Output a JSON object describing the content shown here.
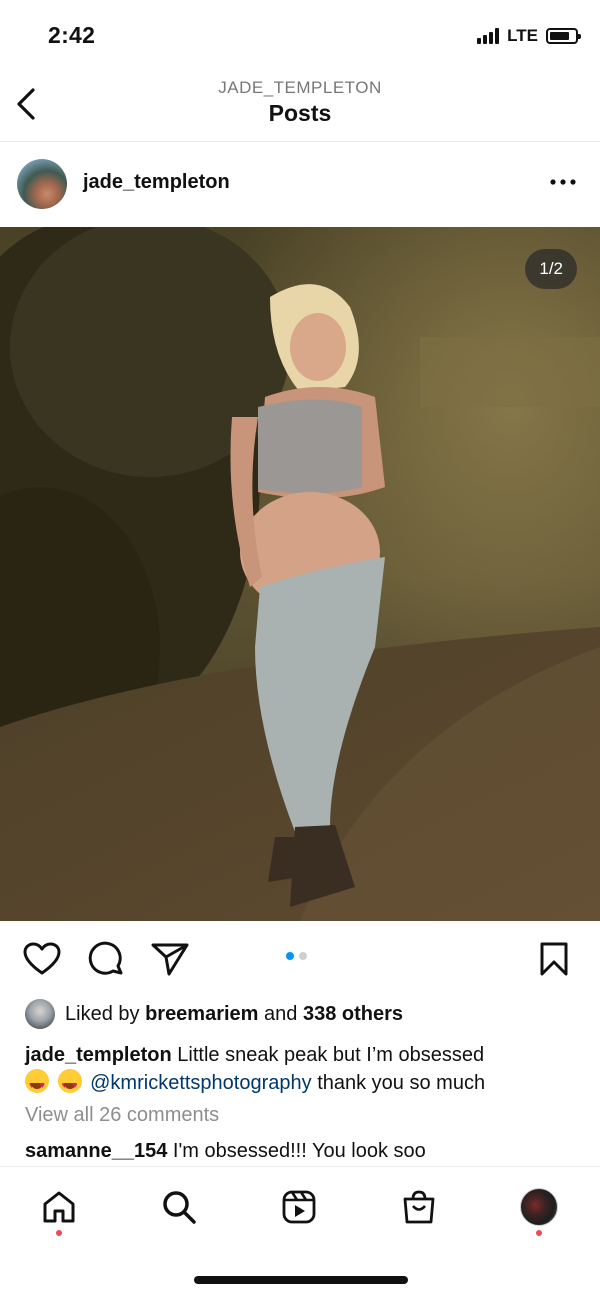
{
  "status_bar": {
    "time": "2:42",
    "network": "LTE"
  },
  "header": {
    "subtitle": "JADE_TEMPLETON",
    "title": "Posts"
  },
  "post": {
    "username": "jade_templeton",
    "media_counter": "1/2",
    "likes": {
      "prefix": "Liked by",
      "user": "breemariem",
      "middle": "and",
      "others": "338 others"
    },
    "caption": {
      "user": "jade_templeton",
      "text": "Little sneak peak but I’m obsessed",
      "mention": "@kmrickettsphotography",
      "suffix": "thank you so much"
    },
    "view_comments": "View all 26 comments",
    "comment": {
      "user": "samanne__154",
      "text": "I'm obsessed!!! You look soo"
    }
  },
  "colors": {
    "link": "#00376b",
    "active_dot": "#0095f6",
    "notification_dot": "#ed4956"
  },
  "icons": [
    "back-icon",
    "more-icon",
    "heart-icon",
    "comment-icon",
    "share-icon",
    "bookmark-icon",
    "home-icon",
    "search-icon",
    "reels-icon",
    "shop-icon"
  ]
}
